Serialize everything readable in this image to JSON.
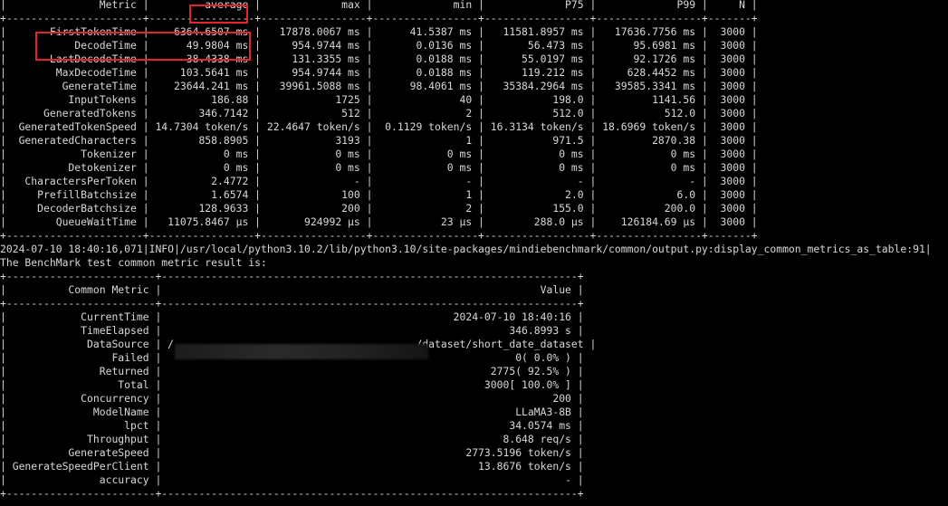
{
  "metrics_table": {
    "columns": [
      "Metric",
      "average",
      "max",
      "min",
      "P75",
      "P99",
      "N"
    ],
    "rows": [
      [
        "FirstTokenTime",
        "6364.6507 ms",
        "17878.0067 ms",
        "41.5387 ms",
        "11581.8957 ms",
        "17636.7756 ms",
        "3000"
      ],
      [
        "DecodeTime",
        "49.9804 ms",
        "954.9744 ms",
        "0.0136 ms",
        "56.473 ms",
        "95.6981 ms",
        "3000"
      ],
      [
        "LastDecodeTime",
        "38.4338 ms",
        "131.3355 ms",
        "0.0188 ms",
        "55.0197 ms",
        "92.1726 ms",
        "3000"
      ],
      [
        "MaxDecodeTime",
        "103.5641 ms",
        "954.9744 ms",
        "0.0188 ms",
        "119.212 ms",
        "628.4452 ms",
        "3000"
      ],
      [
        "GenerateTime",
        "23644.241 ms",
        "39961.5088 ms",
        "98.4061 ms",
        "35384.2964 ms",
        "39585.3341 ms",
        "3000"
      ],
      [
        "InputTokens",
        "186.88",
        "1725",
        "40",
        "198.0",
        "1141.56",
        "3000"
      ],
      [
        "GeneratedTokens",
        "346.7142",
        "512",
        "2",
        "512.0",
        "512.0",
        "3000"
      ],
      [
        "GeneratedTokenSpeed",
        "14.7304 token/s",
        "22.4647 token/s",
        "0.1129 token/s",
        "16.3134 token/s",
        "18.6969 token/s",
        "3000"
      ],
      [
        "GeneratedCharacters",
        "858.8905",
        "3193",
        "1",
        "971.5",
        "2870.38",
        "3000"
      ],
      [
        "Tokenizer",
        "0 ms",
        "0 ms",
        "0 ms",
        "0 ms",
        "0 ms",
        "3000"
      ],
      [
        "Detokenizer",
        "0 ms",
        "0 ms",
        "0 ms",
        "0 ms",
        "0 ms",
        "3000"
      ],
      [
        "CharactersPerToken",
        "2.4772",
        "-",
        "-",
        "-",
        "-",
        "3000"
      ],
      [
        "PrefillBatchsize",
        "1.6574",
        "100",
        "1",
        "2.0",
        "6.0",
        "3000"
      ],
      [
        "DecoderBatchsize",
        "128.9633",
        "200",
        "2",
        "155.0",
        "200.0",
        "3000"
      ],
      [
        "QueueWaitTime",
        "11075.8467 μs",
        "924992 μs",
        "23 μs",
        "288.0 μs",
        "126184.69 μs",
        "3000"
      ]
    ]
  },
  "log_line": "2024-07-10 18:40:16,071|INFO|/usr/local/python3.10.2/lib/python3.10/site-packages/mindiebenchmark/common/output.py:display_common_metrics_as_table:91|",
  "result_title": "The BenchMark test common metric result is:",
  "common_table": {
    "columns": [
      "Common Metric",
      "Value"
    ],
    "rows": [
      [
        "CurrentTime",
        "2024-07-10 18:40:16"
      ],
      [
        "TimeElapsed",
        "346.8993 s"
      ],
      [
        "DataSource",
        "/                                       /dataset/short_date_dataset"
      ],
      [
        "Failed",
        "0( 0.0% )"
      ],
      [
        "Returned",
        "2775( 92.5% )"
      ],
      [
        "Total",
        "3000[ 100.0% ]"
      ],
      [
        "Concurrency",
        "200"
      ],
      [
        "ModelName",
        "LLaMA3-8B"
      ],
      [
        "lpct",
        "34.0574 ms"
      ],
      [
        "Throughput",
        "8.648 req/s"
      ],
      [
        "GenerateSpeed",
        "2773.5196 token/s"
      ],
      [
        "GenerateSpeedPerClient",
        "13.8676 token/s"
      ],
      [
        "accuracy",
        "-"
      ]
    ]
  },
  "colors": {
    "background": "#000000",
    "text": "#d8d8d8",
    "highlight": "#e0262b"
  }
}
